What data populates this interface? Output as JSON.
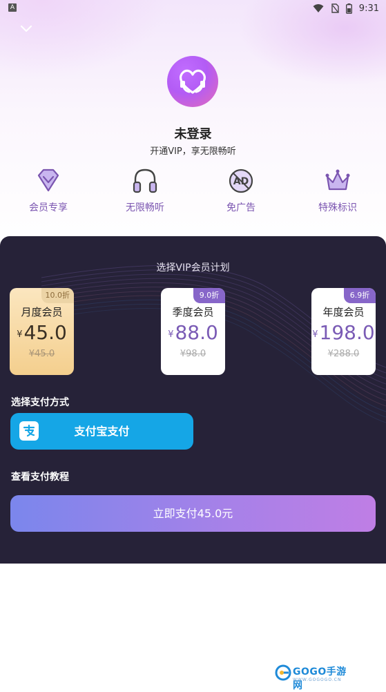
{
  "status_bar": {
    "time": "9:31",
    "notif_letter": "A"
  },
  "header": {
    "title": "未登录",
    "subtitle": "开通VIP，享无限畅听"
  },
  "benefits": [
    {
      "label": "会员专享",
      "icon": "diamond-icon"
    },
    {
      "label": "无限畅听",
      "icon": "headphones-icon"
    },
    {
      "label": "免广告",
      "icon": "no-ad-icon"
    },
    {
      "label": "特殊标识",
      "icon": "crown-icon"
    }
  ],
  "plans": {
    "title": "选择VIP会员计划",
    "items": [
      {
        "name": "月度会员",
        "currency": "¥",
        "price": "45.0",
        "original": "¥45.0",
        "discount": "10.0折",
        "selected": true
      },
      {
        "name": "季度会员",
        "currency": "¥",
        "price": "88.0",
        "original": "¥98.0",
        "discount": "9.0折",
        "selected": false
      },
      {
        "name": "年度会员",
        "currency": "¥",
        "price": "198.0",
        "original": "¥288.0",
        "discount": "6.9折",
        "selected": false
      }
    ]
  },
  "payment": {
    "title": "选择支付方式",
    "alipay_label": "支付宝支付",
    "tutorial_label": "查看支付教程",
    "pay_button": "立即支付45.0元"
  },
  "watermark": {
    "text": "GOGO手游网",
    "url": "WWW.GOGOGO.CN"
  },
  "colors": {
    "panel": "#262238",
    "accent": "#7a5bb5",
    "alipay": "#15a6e6"
  }
}
